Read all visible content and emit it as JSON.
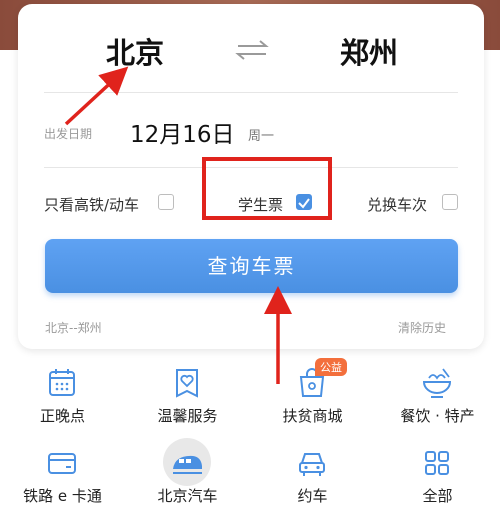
{
  "route": {
    "from_city": "北京",
    "to_city": "郑州"
  },
  "date": {
    "label": "出发日期",
    "value": "12月16日",
    "weekday": "周一"
  },
  "options": [
    {
      "label": "只看高铁/动车",
      "checked": false
    },
    {
      "label": "学生票",
      "checked": true
    },
    {
      "label": "兑换车次",
      "checked": false
    }
  ],
  "search_button": {
    "label": "查询车票"
  },
  "history": {
    "item": "北京--郑州",
    "clear_label": "清除历史"
  },
  "services": [
    {
      "label": "正晚点",
      "icon": "calendar-icon"
    },
    {
      "label": "温馨服务",
      "icon": "heart-icon"
    },
    {
      "label": "扶贫商城",
      "icon": "shop-icon",
      "badge": "公益"
    },
    {
      "label": "餐饮 · 特产",
      "icon": "food-bowl-icon"
    },
    {
      "label": "铁路 e 卡通",
      "icon": "card-icon"
    },
    {
      "label": "北京汽车",
      "icon": "train-icon"
    },
    {
      "label": "约车",
      "icon": "car-icon"
    },
    {
      "label": "全部",
      "icon": "grid-icon"
    }
  ],
  "colors": {
    "accent": "#4a90e2",
    "highlight": "#e0231c",
    "badge": "#f36f3c"
  }
}
